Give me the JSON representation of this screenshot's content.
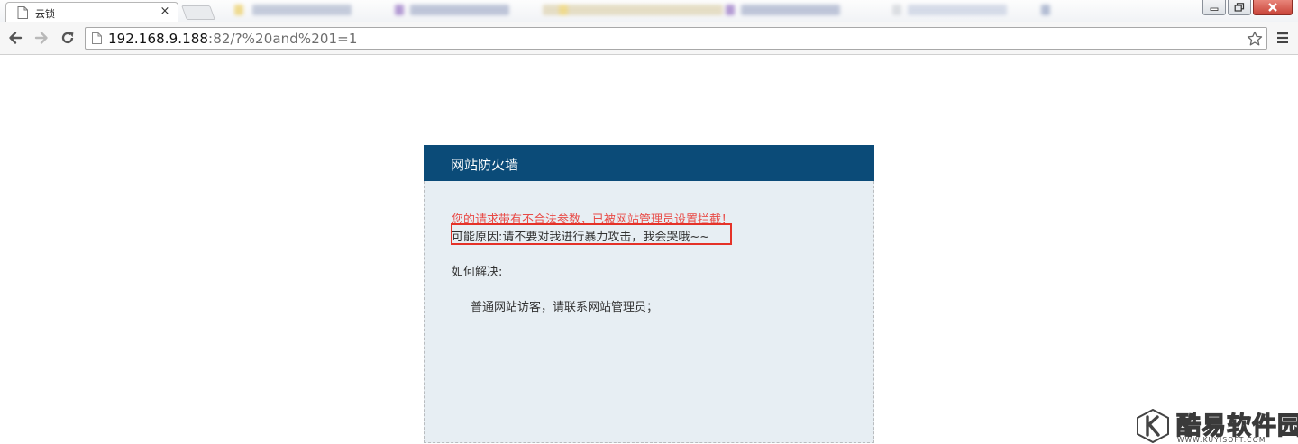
{
  "browser": {
    "tab": {
      "title": "云锁",
      "icon": "page-icon",
      "close_glyph": "×"
    },
    "window_controls": {
      "minimize": "minimize-icon",
      "maximize": "maximize-icon",
      "close": "close-icon"
    },
    "toolbar": {
      "url_host": "192.168.9.188",
      "url_rest": ":82/?%20and%201=1"
    }
  },
  "firewall": {
    "header_title": "网站防火墙",
    "warning": "您的请求带有不合法参数，已被网站管理员设置拦截！",
    "reason": "可能原因:请不要对我进行暴力攻击，我会哭哦~~",
    "how_title": "如何解决:",
    "solution": "普通网站访客，请联系网站管理员；"
  },
  "watermark": {
    "name": "酷易软件园",
    "url": "WWW.KUYISOFT.COM"
  },
  "colors": {
    "header_bg": "#0b4b78",
    "body_bg": "#e7eef3",
    "warning_text": "#e84b47",
    "highlight_box": "#e53228"
  }
}
